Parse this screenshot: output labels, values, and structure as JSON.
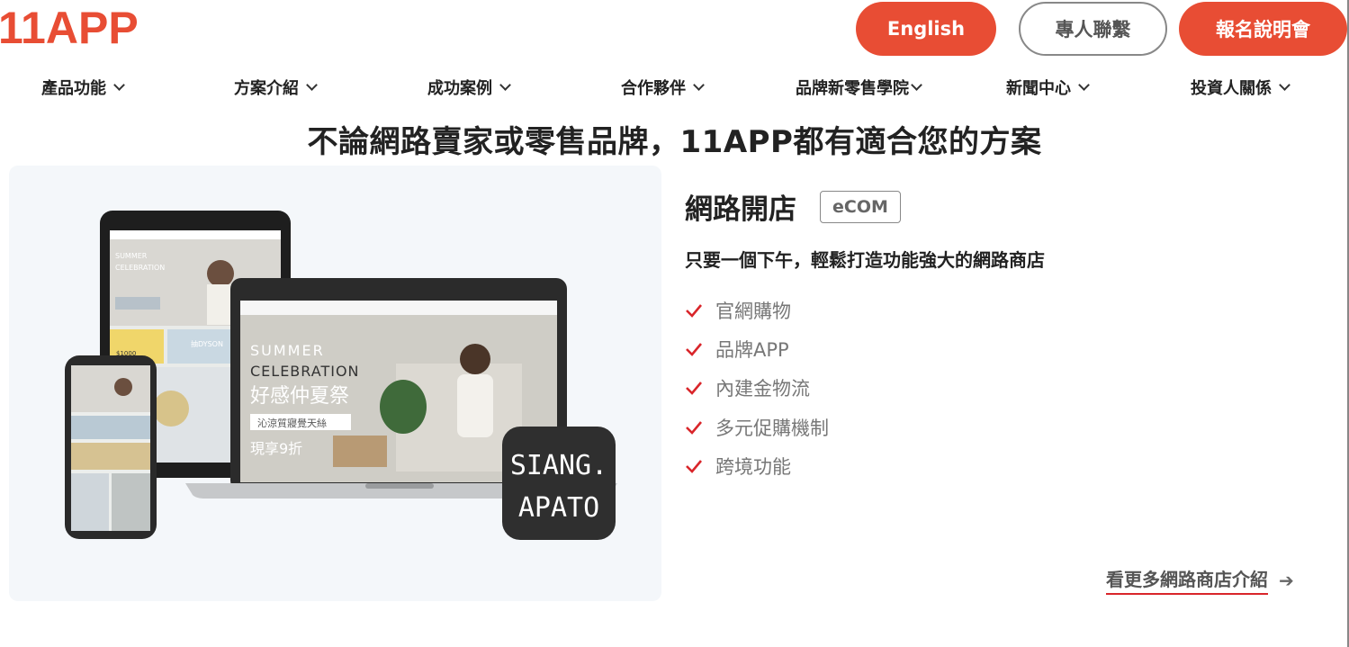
{
  "brand": {
    "logo": "11APP",
    "accent": "#e84d34"
  },
  "header": {
    "english_label": "English",
    "contact_label": "專人聯繫",
    "info_session_label": "報名說明會"
  },
  "nav": {
    "items": [
      {
        "label": "產品功能"
      },
      {
        "label": "方案介紹"
      },
      {
        "label": "成功案例"
      },
      {
        "label": "合作夥伴"
      },
      {
        "label": "品牌新零售學院"
      },
      {
        "label": "新聞中心"
      },
      {
        "label": "投資人關係"
      }
    ]
  },
  "headline": "不論網路賣家或零售品牌，11APP都有適合您的方案",
  "section": {
    "title": "網路開店",
    "badge": "eCOM",
    "subtitle": "只要一個下午，輕鬆打造功能強大的網路商店",
    "features": [
      "官網購物",
      "品牌APP",
      "內建金物流",
      "多元促購機制",
      "跨境功能"
    ],
    "more_link": "看更多網路商店介紹",
    "more_arrow_icon": "arrow-right-icon"
  },
  "showcase": {
    "hero_line1": "SUMMER",
    "hero_line2": "CELEBRATION",
    "hero_cn": "好感仲夏祭",
    "hero_tag": "沁涼質寢覺天絲",
    "hero_offer": "現享9折",
    "app_icon_line1": "SIANG.",
    "app_icon_line2": "APATO",
    "promo_1": "$1000",
    "promo_2": "抽DYSON"
  }
}
